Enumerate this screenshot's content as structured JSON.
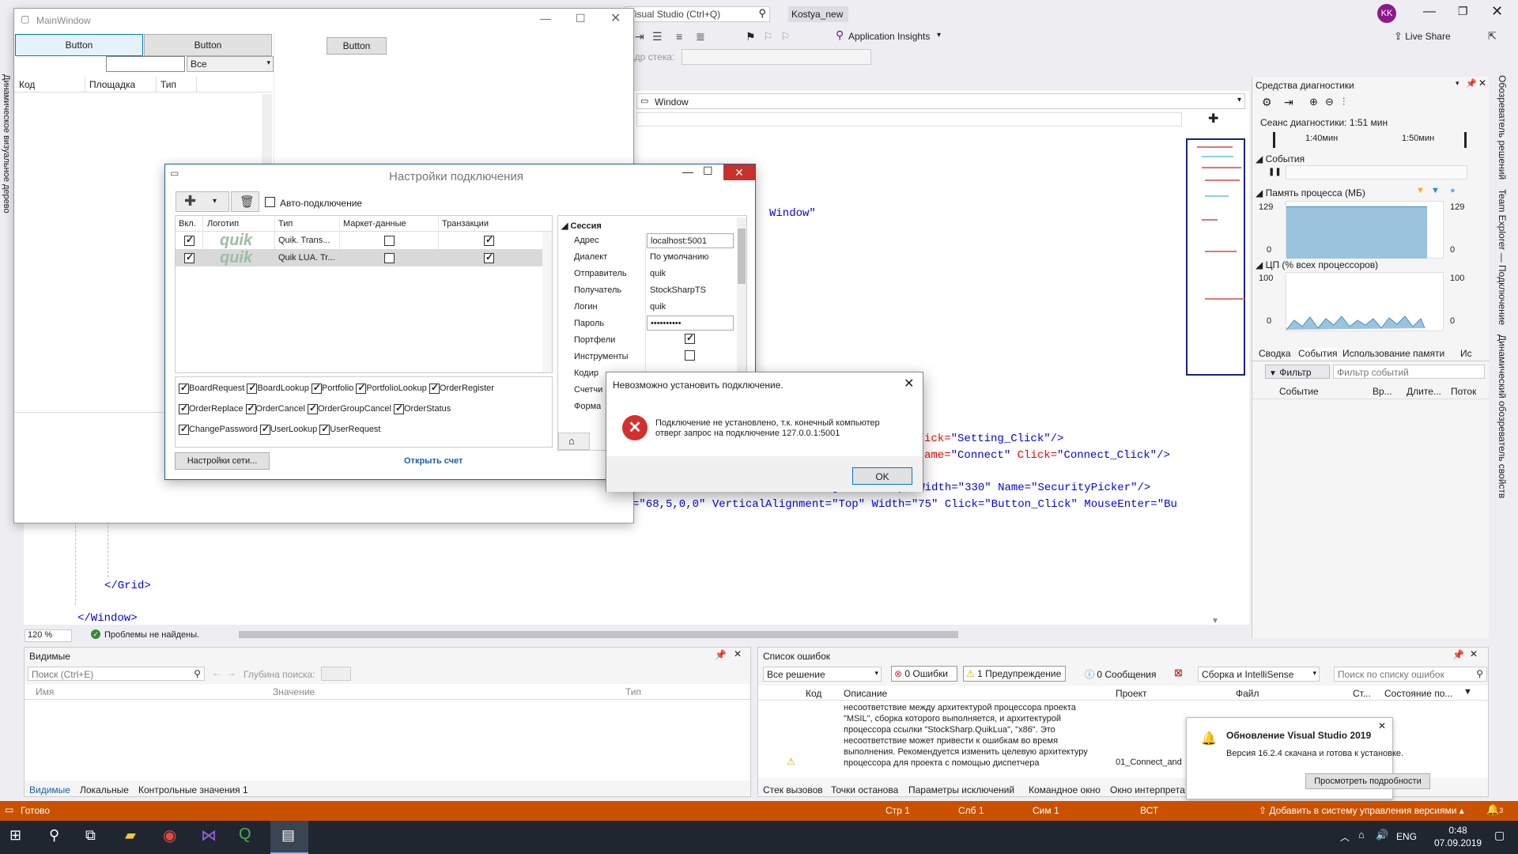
{
  "vs": {
    "search_placeholder": "Visual Studio (Ctrl+Q)",
    "solution_name": "Kostya_new",
    "avatar": "KK",
    "app_insights": "Application Insights",
    "live_share": "Live Share",
    "stack_frame_label": "адр стека:",
    "window_combo": "Window",
    "zoom": "120 %",
    "no_issues": "Проблемы не найдены.",
    "code": {
      "line1_attr": "Window\"",
      "line2_a": "ick=",
      "line2_b": "\"Setting_Click\"",
      "line2_c": "/>",
      "line3_a": "ame=",
      "line3_b": "\"Connect\"",
      "line3_c": " Click=",
      "line3_d": "\"Connect_Click\"",
      "line3_e": "/>",
      "line4": "=\"15\" Grid.Row=\"1\" VerticalAlignment=\"Top\" Width=\"330\" Name=\"SecurityPicker\"/>",
      "line5": "=\"68,5,0,0\" VerticalAlignment=\"Top\" Width=\"75\" Click=\"Button_Click\" MouseEnter=\"Bu",
      "grid_close": "</Grid>",
      "window_close": "</Window>"
    },
    "left_vertical": "Динамическое визуальное дерево",
    "right_vertical_1": "Обозреватель решений",
    "right_vertical_2": "Team Explorer — Подключение",
    "right_vertical_3": "Динамический обозреватель свойств"
  },
  "main_window": {
    "title": "MainWindow",
    "button1": "Button",
    "button2": "Button",
    "button3": "Button",
    "combo_value": "Все",
    "columns": [
      "Код",
      "Площадка",
      "Тип"
    ]
  },
  "conn_dialog": {
    "title": "Настройки подключения",
    "auto_connect": "Авто-подключение",
    "columns": [
      "Вкл.",
      "Логотип",
      "Тип",
      "Маркет-данные",
      "Транзакции"
    ],
    "rows": [
      {
        "enabled": true,
        "logo": "quik",
        "type": "Quik. Trans...",
        "market": false,
        "trans": true
      },
      {
        "enabled": true,
        "logo": "quik",
        "type": "Quik LUA. Tr...",
        "market": false,
        "trans": true
      }
    ],
    "messages": [
      [
        "BoardRequest",
        "BoardLookup",
        "Portfolio",
        "PortfolioLookup",
        "OrderRegister"
      ],
      [
        "OrderReplace",
        "OrderCancel",
        "OrderGroupCancel",
        "OrderStatus"
      ],
      [
        "ChangePassword",
        "UserLookup",
        "UserRequest"
      ]
    ],
    "net_settings": "Настройки сети...",
    "open_account": "Открыть счет",
    "props_header": "Сессия",
    "props": [
      {
        "name": "Адрес",
        "value": "localhost:5001"
      },
      {
        "name": "Диалект",
        "value": "По умолчанию"
      },
      {
        "name": "Отправитель",
        "value": "quik"
      },
      {
        "name": "Получатель",
        "value": "StockSharpTS"
      },
      {
        "name": "Логин",
        "value": "quik"
      },
      {
        "name": "Пароль",
        "value": "••••••••••"
      },
      {
        "name": "Портфели",
        "value": ""
      },
      {
        "name": "Инструменты",
        "value": ""
      },
      {
        "name": "Кодир",
        "value": ""
      },
      {
        "name": "Счетчи",
        "value": ""
      },
      {
        "name": "Форма",
        "value": ""
      }
    ]
  },
  "error_dialog": {
    "title": "Невозможно установить подключение.",
    "message_line1": "Подключение не установлено, т.к. конечный компьютер",
    "message_line2": "отверг запрос на подключение 127.0.0.1:5001",
    "ok": "OK"
  },
  "diagnostics": {
    "title": "Средства диагностики",
    "session": "Сеанс диагностики: 1:51 мин",
    "tick1": "1:40мин",
    "tick2": "1:50мин",
    "events": "События",
    "memory": "Память процесса (МБ)",
    "mem_max": "129",
    "mem_min": "0",
    "cpu": "ЦП (% всех процессоров)",
    "cpu_max": "100",
    "cpu_min": "0",
    "tabs": [
      "Сводка",
      "События",
      "Использование памяти",
      "Ис"
    ],
    "filter": "Фильтр",
    "filter_placeholder": "Фильтр событий",
    "cols": [
      "Событие",
      "Вр...",
      "Длите...",
      "Поток"
    ]
  },
  "watch": {
    "title": "Видимые",
    "search": "Поиск (Ctrl+E)",
    "depth": "Глубина поиска:",
    "cols": [
      "Имя",
      "Значение",
      "Тип"
    ],
    "tabs": [
      "Видимые",
      "Локальные",
      "Контрольные значения 1"
    ]
  },
  "errors": {
    "title": "Список ошибок",
    "scope": "Все решение",
    "errors_btn": "0 Ошибки",
    "warnings_btn": "1 Предупреждение",
    "messages_btn": "0 Сообщения",
    "build": "Сборка и IntelliSense",
    "search": "Поиск по списку ошибок",
    "cols": [
      "Код",
      "Описание",
      "Проект",
      "Файл",
      "Ст...",
      "Состояние по..."
    ],
    "desc": [
      "несоответствие между архитектурой процессора проекта",
      "\"MSIL\", сборка которого выполняется, и архитектурой",
      "процессора ссылки \"StockSharp.QuikLua\", \"x86\". Это",
      "несоответствие может привести к ошибкам во время",
      "выполнения. Рекомендуется изменить целевую архитектуру",
      "процессора для проекта с помощью диспетчера"
    ],
    "project": "01_Connect_and",
    "bottom_tabs": [
      "Стек вызовов",
      "Точки останова",
      "Параметры исключений",
      "Командное окно",
      "Окно интерпрета"
    ]
  },
  "toast": {
    "title": "Обновление Visual Studio 2019",
    "body": "Версия 16.2.4 скачана и готова к установке.",
    "button": "Просмотреть подробности"
  },
  "status": {
    "ready": "Готово",
    "line": "Стр 1",
    "col": "Слб 1",
    "ch": "Сим 1",
    "ins": "ВСТ",
    "vcs": "Добавить в систему управления версиями",
    "notif": "3"
  },
  "taskbar": {
    "lang": "ENG",
    "time": "0:48",
    "date": "07.09.2019"
  },
  "colors": {
    "status_bar": "#ca5100",
    "accent": "#007acc",
    "close_red": "#e81123",
    "taskbar": "#1f2630"
  }
}
